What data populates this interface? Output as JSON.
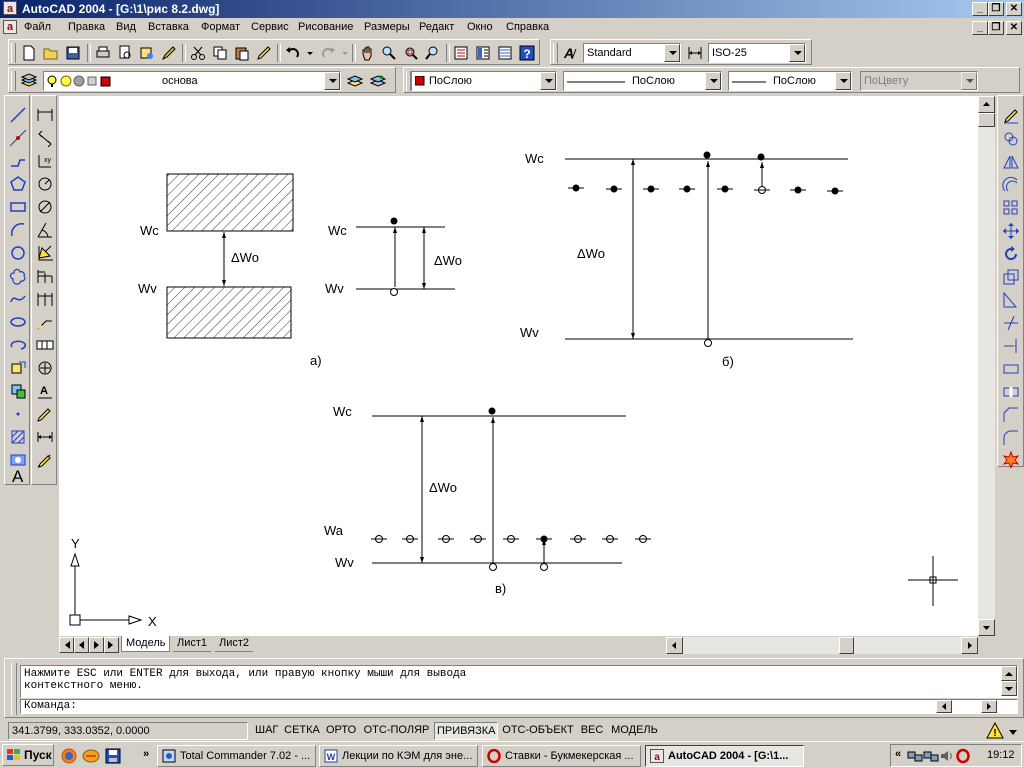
{
  "window": {
    "title": "AutoCAD 2004 - [G:\\1\\рис 8.2.dwg]",
    "app_icon": "a"
  },
  "menu": {
    "items": [
      "Файл",
      "Правка",
      "Вид",
      "Вставка",
      "Формат",
      "Сервис",
      "Рисование",
      "Размеры",
      "Редакт",
      "Окно",
      "Справка"
    ]
  },
  "standard_toolbar": {
    "text_style": "Standard",
    "dim_style": "ISO-25"
  },
  "layers_toolbar": {
    "layer_name": "основа",
    "layer_color": "#cc0000",
    "color_value": "ПоСлою",
    "linetype_value": "ПоСлою",
    "lineweight_value": "ПоСлою",
    "plotstyle_value": "ПоЦвету"
  },
  "drawing": {
    "fig_a": {
      "wc": "Wc",
      "wv": "Wv",
      "delta": "ΔWo",
      "caption": "а)"
    },
    "fig_a2": {
      "wc": "Wc",
      "wv": "Wv",
      "delta": "ΔWo"
    },
    "fig_b": {
      "wc": "Wc",
      "wv": "Wv",
      "delta": "ΔWo",
      "caption": "б)"
    },
    "fig_c": {
      "wc": "Wc",
      "wa": "Wa",
      "wv": "Wv",
      "delta": "ΔWo",
      "caption": "в)"
    },
    "ucs": {
      "y": "Y",
      "x": "X"
    }
  },
  "layout_tabs": [
    "Модель",
    "Лист1",
    "Лист2"
  ],
  "command": {
    "line1": "Нажмите ESC или ENTER для выхода, или правую кнопку мыши для вывода",
    "line2": "контекстного меню.",
    "prompt": "Команда:"
  },
  "status": {
    "coords": "341.3799, 333.0352, 0.0000",
    "buttons": [
      {
        "label": "ШАГ",
        "on": false
      },
      {
        "label": "СЕТКА",
        "on": false
      },
      {
        "label": "ОРТО",
        "on": false
      },
      {
        "label": "ОТС-ПОЛЯР",
        "on": false
      },
      {
        "label": "ПРИВЯЗКА",
        "on": true
      },
      {
        "label": "ОТС-ОБЪЕКТ",
        "on": false
      },
      {
        "label": "ВЕС",
        "on": false
      },
      {
        "label": "МОДЕЛЬ",
        "on": false
      }
    ]
  },
  "taskbar": {
    "start": "Пуск",
    "tasks": [
      "Total Commander 7.02 - ...",
      "Лекции по КЭМ для эне...",
      "Ставки - Букмекерская ...",
      "AutoCAD 2004 - [G:\\1..."
    ],
    "clock": "19:12",
    "quick_launch_more": "»",
    "tray_more": "«"
  }
}
